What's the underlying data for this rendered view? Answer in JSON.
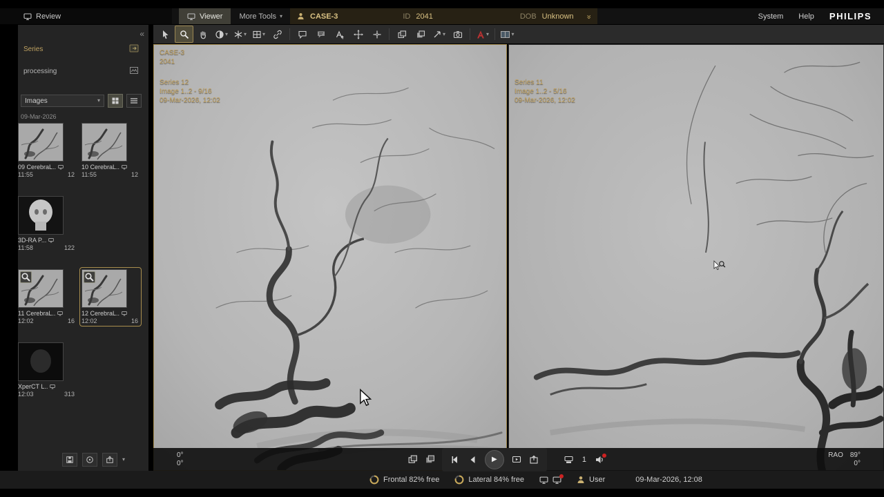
{
  "header": {
    "review": "Review",
    "viewer_tab": "Viewer",
    "more_tools": "More Tools",
    "patient": {
      "name": "CASE-3",
      "id_label": "ID",
      "id": "2041",
      "dob_label": "DOB",
      "dob": "Unknown"
    },
    "system": "System",
    "help": "Help",
    "brand": "PHILIPS"
  },
  "toolbar": {
    "active_tool": "zoom",
    "tools": [
      "select",
      "zoom",
      "pan",
      "window-level",
      "sharpen",
      "grid",
      "link",
      "comment",
      "annotation",
      "text-marker",
      "move-crosshair",
      "crosshair",
      "compare",
      "subtract",
      "arrow",
      "snapshot",
      "vessel-analysis",
      "layout"
    ]
  },
  "sidebar": {
    "series_label": "Series",
    "processing_label": "processing",
    "images_label": "Images",
    "date_header": "09-Mar-2026",
    "thumbnails": [
      {
        "label": "09 CerebraL..",
        "time": "11:55",
        "count": "12"
      },
      {
        "label": "10 CerebraL..",
        "time": "11:55",
        "count": "12"
      },
      {
        "label": "3D-RA P...",
        "time": "11:58",
        "count": "122"
      },
      {
        "label": "11 CerebraL..",
        "time": "12:02",
        "count": "16"
      },
      {
        "label": "12 CerebraL..",
        "time": "12:02",
        "count": "16"
      },
      {
        "label": "XperCT L..",
        "time": "12:03",
        "count": "313"
      }
    ]
  },
  "viewer": {
    "left": {
      "case": "CASE-3",
      "id": "2041",
      "series": "Series 12",
      "image_info": "Image 1..2 - 9/16",
      "datetime": "09-Mar-2026, 12:02",
      "angle1": "0°",
      "angle2": "0°"
    },
    "right": {
      "series": "Series 11",
      "image_info": "Image 1..2 - 5/16",
      "datetime": "09-Mar-2026, 12:02",
      "position": "RAO",
      "angle1": "89°",
      "angle2": "0°"
    },
    "controls": {
      "frame": "1"
    }
  },
  "statusbar": {
    "frontal": "Frontal 82% free",
    "lateral": "Lateral 84% free",
    "user": "User",
    "datetime": "09-Mar-2026, 12:08"
  }
}
